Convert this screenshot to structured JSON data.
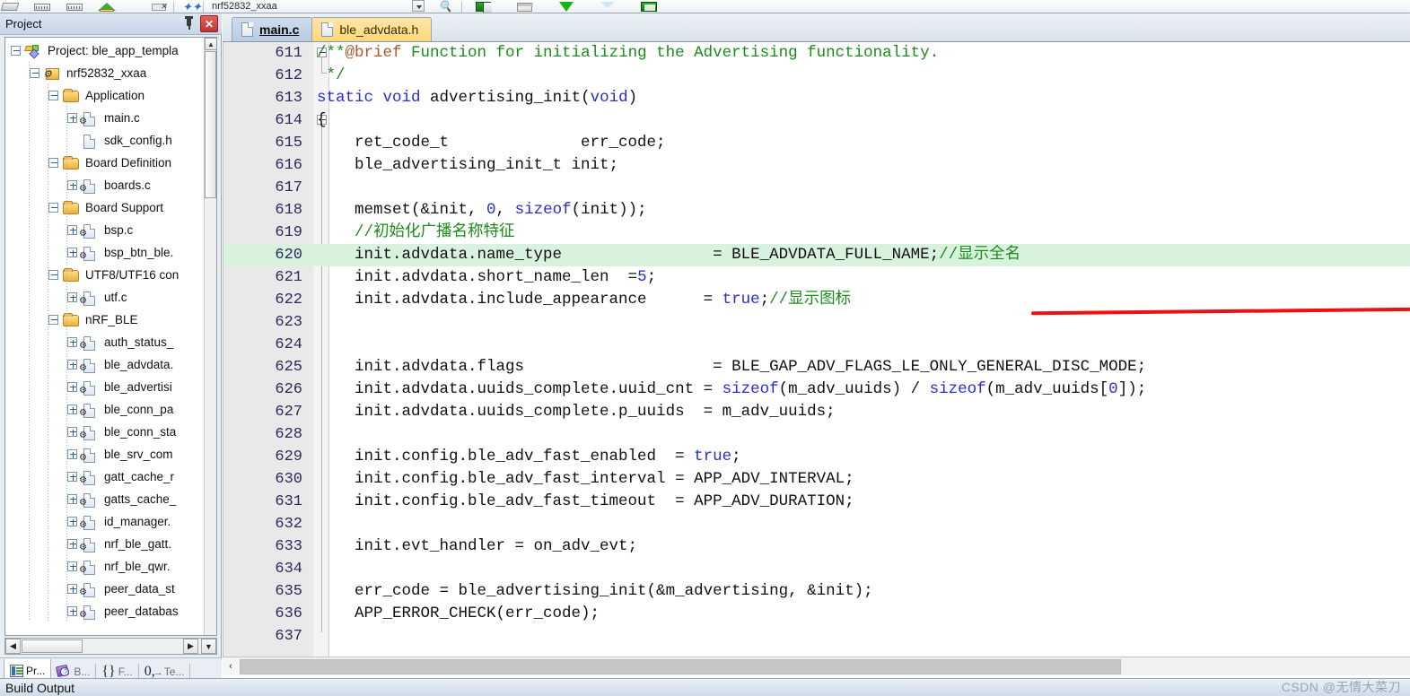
{
  "toolbar": {
    "target_combo_value": "nrf52832_xxaa",
    "icons": [
      "build-target-icon",
      "memory-window-icon",
      "registers-window-icon",
      "rebuild-icon",
      "stop-build-icon",
      "bookmark-icon"
    ],
    "right_icons": [
      "dropdown-arrow-icon",
      "find-in-files-icon",
      "project-window-icon",
      "books-window-icon",
      "download-icon",
      "filter-icon",
      "configure-window-icon"
    ]
  },
  "project_panel": {
    "title": "Project",
    "pin_label": "⚐",
    "close_label": "✕",
    "tree": [
      {
        "indent": 0,
        "expander": "minus",
        "icon": "project-icon",
        "label": "Project: ble_app_templa"
      },
      {
        "indent": 1,
        "expander": "minus",
        "icon": "target-icon",
        "label": "nrf52832_xxaa"
      },
      {
        "indent": 2,
        "expander": "minus",
        "icon": "folder-icon",
        "label": "Application"
      },
      {
        "indent": 3,
        "expander": "plus",
        "icon": "c-file-icon",
        "label": "main.c"
      },
      {
        "indent": 3,
        "expander": "none",
        "icon": "h-file-icon",
        "label": "sdk_config.h"
      },
      {
        "indent": 2,
        "expander": "minus",
        "icon": "folder-icon",
        "label": "Board Definition"
      },
      {
        "indent": 3,
        "expander": "plus",
        "icon": "c-file-icon",
        "label": "boards.c"
      },
      {
        "indent": 2,
        "expander": "minus",
        "icon": "folder-icon",
        "label": "Board Support"
      },
      {
        "indent": 3,
        "expander": "plus",
        "icon": "c-file-icon",
        "label": "bsp.c"
      },
      {
        "indent": 3,
        "expander": "plus",
        "icon": "c-file-icon",
        "label": "bsp_btn_ble."
      },
      {
        "indent": 2,
        "expander": "minus",
        "icon": "folder-icon",
        "label": "UTF8/UTF16 con"
      },
      {
        "indent": 3,
        "expander": "plus",
        "icon": "c-file-icon",
        "label": "utf.c"
      },
      {
        "indent": 2,
        "expander": "minus",
        "icon": "folder-icon",
        "label": "nRF_BLE"
      },
      {
        "indent": 3,
        "expander": "plus",
        "icon": "c-file-icon",
        "label": "auth_status_"
      },
      {
        "indent": 3,
        "expander": "plus",
        "icon": "c-file-icon",
        "label": "ble_advdata."
      },
      {
        "indent": 3,
        "expander": "plus",
        "icon": "c-file-icon",
        "label": "ble_advertisi"
      },
      {
        "indent": 3,
        "expander": "plus",
        "icon": "c-file-icon",
        "label": "ble_conn_pa"
      },
      {
        "indent": 3,
        "expander": "plus",
        "icon": "c-file-icon",
        "label": "ble_conn_sta"
      },
      {
        "indent": 3,
        "expander": "plus",
        "icon": "c-file-icon",
        "label": "ble_srv_com"
      },
      {
        "indent": 3,
        "expander": "plus",
        "icon": "c-file-icon",
        "label": "gatt_cache_r"
      },
      {
        "indent": 3,
        "expander": "plus",
        "icon": "c-file-icon",
        "label": "gatts_cache_"
      },
      {
        "indent": 3,
        "expander": "plus",
        "icon": "c-file-icon",
        "label": "id_manager."
      },
      {
        "indent": 3,
        "expander": "plus",
        "icon": "c-file-icon",
        "label": "nrf_ble_gatt."
      },
      {
        "indent": 3,
        "expander": "plus",
        "icon": "c-file-icon",
        "label": "nrf_ble_qwr."
      },
      {
        "indent": 3,
        "expander": "plus",
        "icon": "c-file-icon",
        "label": "peer_data_st"
      },
      {
        "indent": 3,
        "expander": "plus",
        "icon": "c-file-icon",
        "label": "peer_databas"
      }
    ],
    "tabs": [
      {
        "label": "Pr...",
        "icon": "project-window-icon",
        "active": true
      },
      {
        "label": "B...",
        "icon": "books-window-icon",
        "active": false
      },
      {
        "label": "F...",
        "icon": "functions-window-icon",
        "active": false
      },
      {
        "label": "Te...",
        "icon": "templates-window-icon",
        "active": false
      }
    ],
    "scroll": {
      "left_arrow": "◀",
      "right_arrow": "▶",
      "down_arrow": "▼",
      "up_arrow": "▲"
    }
  },
  "editor": {
    "tabs": [
      {
        "label": "main.c",
        "active": true
      },
      {
        "label": "ble_advdata.h",
        "active": false
      }
    ],
    "highlight_line": 620,
    "annotation": {
      "type": "red-underline",
      "on_line": 620,
      "color": "#ee1111"
    },
    "scroll": {
      "left_arrow": "‹"
    },
    "lines": [
      {
        "n": 611,
        "fold": "start",
        "segments": [
          {
            "t": "/**",
            "c": "cm"
          },
          {
            "t": "@brief",
            "c": "brief"
          },
          {
            "t": " Function for initializing the Advertising functionality.",
            "c": "cm"
          }
        ]
      },
      {
        "n": 612,
        "fold": "end",
        "segments": [
          {
            "t": " */",
            "c": "cm"
          }
        ]
      },
      {
        "n": 613,
        "fold": "line",
        "segments": [
          {
            "t": "static",
            "c": "kw"
          },
          {
            "t": " ",
            "c": ""
          },
          {
            "t": "void",
            "c": "kw"
          },
          {
            "t": " advertising_init(",
            "c": ""
          },
          {
            "t": "void",
            "c": "kw"
          },
          {
            "t": ")",
            "c": ""
          }
        ]
      },
      {
        "n": 614,
        "fold": "start",
        "segments": [
          {
            "t": "{",
            "c": ""
          }
        ]
      },
      {
        "n": 615,
        "fold": "line",
        "segments": [
          {
            "t": "    ret_code_t              err_code;",
            "c": ""
          }
        ]
      },
      {
        "n": 616,
        "fold": "line",
        "segments": [
          {
            "t": "    ble_advertising_init_t init;",
            "c": ""
          }
        ]
      },
      {
        "n": 617,
        "fold": "line",
        "segments": [
          {
            "t": "",
            "c": ""
          }
        ]
      },
      {
        "n": 618,
        "fold": "line",
        "segments": [
          {
            "t": "    memset(&init, ",
            "c": ""
          },
          {
            "t": "0",
            "c": "num"
          },
          {
            "t": ", ",
            "c": ""
          },
          {
            "t": "sizeof",
            "c": "kw"
          },
          {
            "t": "(init));",
            "c": ""
          }
        ]
      },
      {
        "n": 619,
        "fold": "line",
        "segments": [
          {
            "t": "    //初始化广播名称特征",
            "c": "cm"
          }
        ]
      },
      {
        "n": 620,
        "fold": "line",
        "highlight": true,
        "segments": [
          {
            "t": "    init.advdata.name_type                = BLE_ADVDATA_FULL_NAME;",
            "c": ""
          },
          {
            "t": "//显示全名",
            "c": "cm"
          }
        ]
      },
      {
        "n": 621,
        "fold": "line",
        "segments": [
          {
            "t": "    init.advdata.short_name_len  =",
            "c": ""
          },
          {
            "t": "5",
            "c": "num"
          },
          {
            "t": ";",
            "c": ""
          }
        ]
      },
      {
        "n": 622,
        "fold": "line",
        "segments": [
          {
            "t": "    init.advdata.include_appearance      = ",
            "c": ""
          },
          {
            "t": "true",
            "c": "kw"
          },
          {
            "t": ";",
            "c": ""
          },
          {
            "t": "//显示图标",
            "c": "cm"
          }
        ]
      },
      {
        "n": 623,
        "fold": "line",
        "segments": [
          {
            "t": "",
            "c": ""
          }
        ]
      },
      {
        "n": 624,
        "fold": "line",
        "segments": [
          {
            "t": "",
            "c": ""
          }
        ]
      },
      {
        "n": 625,
        "fold": "line",
        "segments": [
          {
            "t": "    init.advdata.flags                    = BLE_GAP_ADV_FLAGS_LE_ONLY_GENERAL_DISC_MODE;",
            "c": ""
          }
        ]
      },
      {
        "n": 626,
        "fold": "line",
        "segments": [
          {
            "t": "    init.advdata.uuids_complete.uuid_cnt = ",
            "c": ""
          },
          {
            "t": "sizeof",
            "c": "kw"
          },
          {
            "t": "(m_adv_uuids) / ",
            "c": ""
          },
          {
            "t": "sizeof",
            "c": "kw"
          },
          {
            "t": "(m_adv_uuids[",
            "c": ""
          },
          {
            "t": "0",
            "c": "num"
          },
          {
            "t": "]);",
            "c": ""
          }
        ]
      },
      {
        "n": 627,
        "fold": "line",
        "segments": [
          {
            "t": "    init.advdata.uuids_complete.p_uuids  = m_adv_uuids;",
            "c": ""
          }
        ]
      },
      {
        "n": 628,
        "fold": "line",
        "segments": [
          {
            "t": "",
            "c": ""
          }
        ]
      },
      {
        "n": 629,
        "fold": "line",
        "segments": [
          {
            "t": "    init.config.ble_adv_fast_enabled  = ",
            "c": ""
          },
          {
            "t": "true",
            "c": "kw"
          },
          {
            "t": ";",
            "c": ""
          }
        ]
      },
      {
        "n": 630,
        "fold": "line",
        "segments": [
          {
            "t": "    init.config.ble_adv_fast_interval = APP_ADV_INTERVAL;",
            "c": ""
          }
        ]
      },
      {
        "n": 631,
        "fold": "line",
        "segments": [
          {
            "t": "    init.config.ble_adv_fast_timeout  = APP_ADV_DURATION;",
            "c": ""
          }
        ]
      },
      {
        "n": 632,
        "fold": "line",
        "segments": [
          {
            "t": "",
            "c": ""
          }
        ]
      },
      {
        "n": 633,
        "fold": "line",
        "segments": [
          {
            "t": "    init.evt_handler = on_adv_evt;",
            "c": ""
          }
        ]
      },
      {
        "n": 634,
        "fold": "line",
        "segments": [
          {
            "t": "",
            "c": ""
          }
        ]
      },
      {
        "n": 635,
        "fold": "line",
        "segments": [
          {
            "t": "    err_code = ble_advertising_init(&m_advertising, &init);",
            "c": ""
          }
        ]
      },
      {
        "n": 636,
        "fold": "line",
        "segments": [
          {
            "t": "    APP_ERROR_CHECK(err_code);",
            "c": ""
          }
        ]
      },
      {
        "n": 637,
        "fold": "none",
        "segments": [
          {
            "t": "",
            "c": ""
          }
        ]
      }
    ]
  },
  "status": {
    "build_output_label": "Build Output",
    "watermark": "CSDN @无情大菜刀"
  },
  "colors": {
    "highlight_line": "#d9f2dd",
    "annotation_red": "#ee1111",
    "comment_green": "#1a8c1a",
    "keyword_blue": "#2b2bd0",
    "brief_brown": "#a85a2a",
    "active_tab_blue": "#c3d4e8",
    "inactive_tab_yellow": "#fcd878"
  }
}
